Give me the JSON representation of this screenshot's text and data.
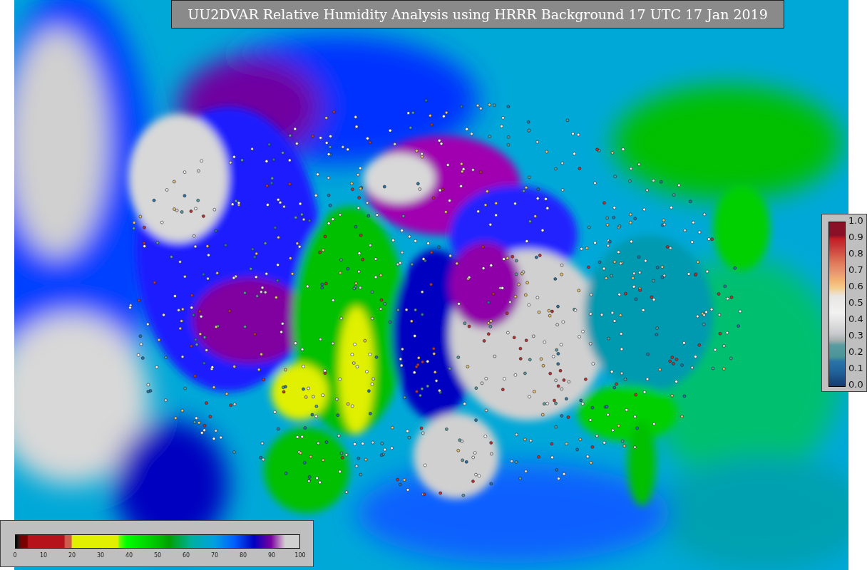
{
  "title": "UU2DVAR Relative Humidity Analysis using HRRR Background 17 UTC 17 Jan 2019",
  "humidity_colorbar": {
    "ticks": [
      "0",
      "10",
      "20",
      "30",
      "40",
      "50",
      "60",
      "70",
      "80",
      "90",
      "100"
    ]
  },
  "observation_colorbar": {
    "ticks": [
      "1.0",
      "0.9",
      "0.8",
      "0.7",
      "0.6",
      "0.5",
      "0.4",
      "0.3",
      "0.2",
      "0.1",
      "0.0"
    ]
  }
}
